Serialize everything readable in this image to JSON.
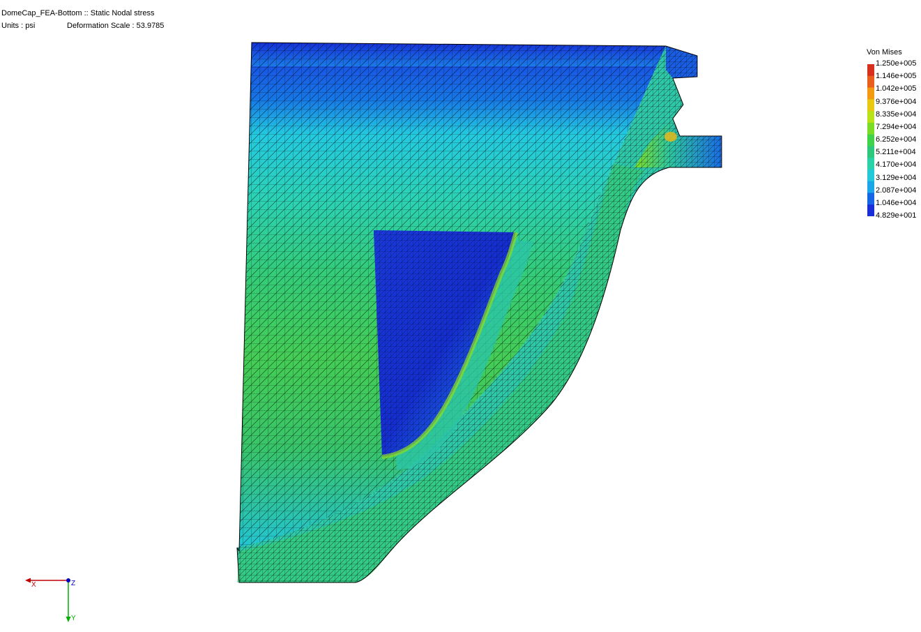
{
  "header": {
    "title": "DomeCap_FEA-Bottom :: Static Nodal stress",
    "units": "Units : psi",
    "deformation": "Deformation Scale : 53.9785"
  },
  "legend": {
    "title": "Von Mises",
    "ticks": [
      "1.250e+005",
      "1.146e+005",
      "1.042e+005",
      "9.376e+004",
      "8.335e+004",
      "7.294e+004",
      "6.252e+004",
      "5.211e+004",
      "4.170e+004",
      "3.129e+004",
      "2.087e+004",
      "1.046e+004",
      "4.829e+001"
    ],
    "colors": [
      "#d7301f",
      "#e8601b",
      "#f39a12",
      "#e8c811",
      "#b9e219",
      "#7bdc26",
      "#3fd34a",
      "#2ec87c",
      "#2bd2a8",
      "#23c9d8",
      "#1aa6e8",
      "#1466e6",
      "#1a2ed8"
    ]
  },
  "triad": {
    "x_label": "X",
    "y_label": "Y",
    "z_label": "Z",
    "x_color": "#c00000",
    "y_color": "#00b000",
    "z_color": "#0000c0"
  }
}
